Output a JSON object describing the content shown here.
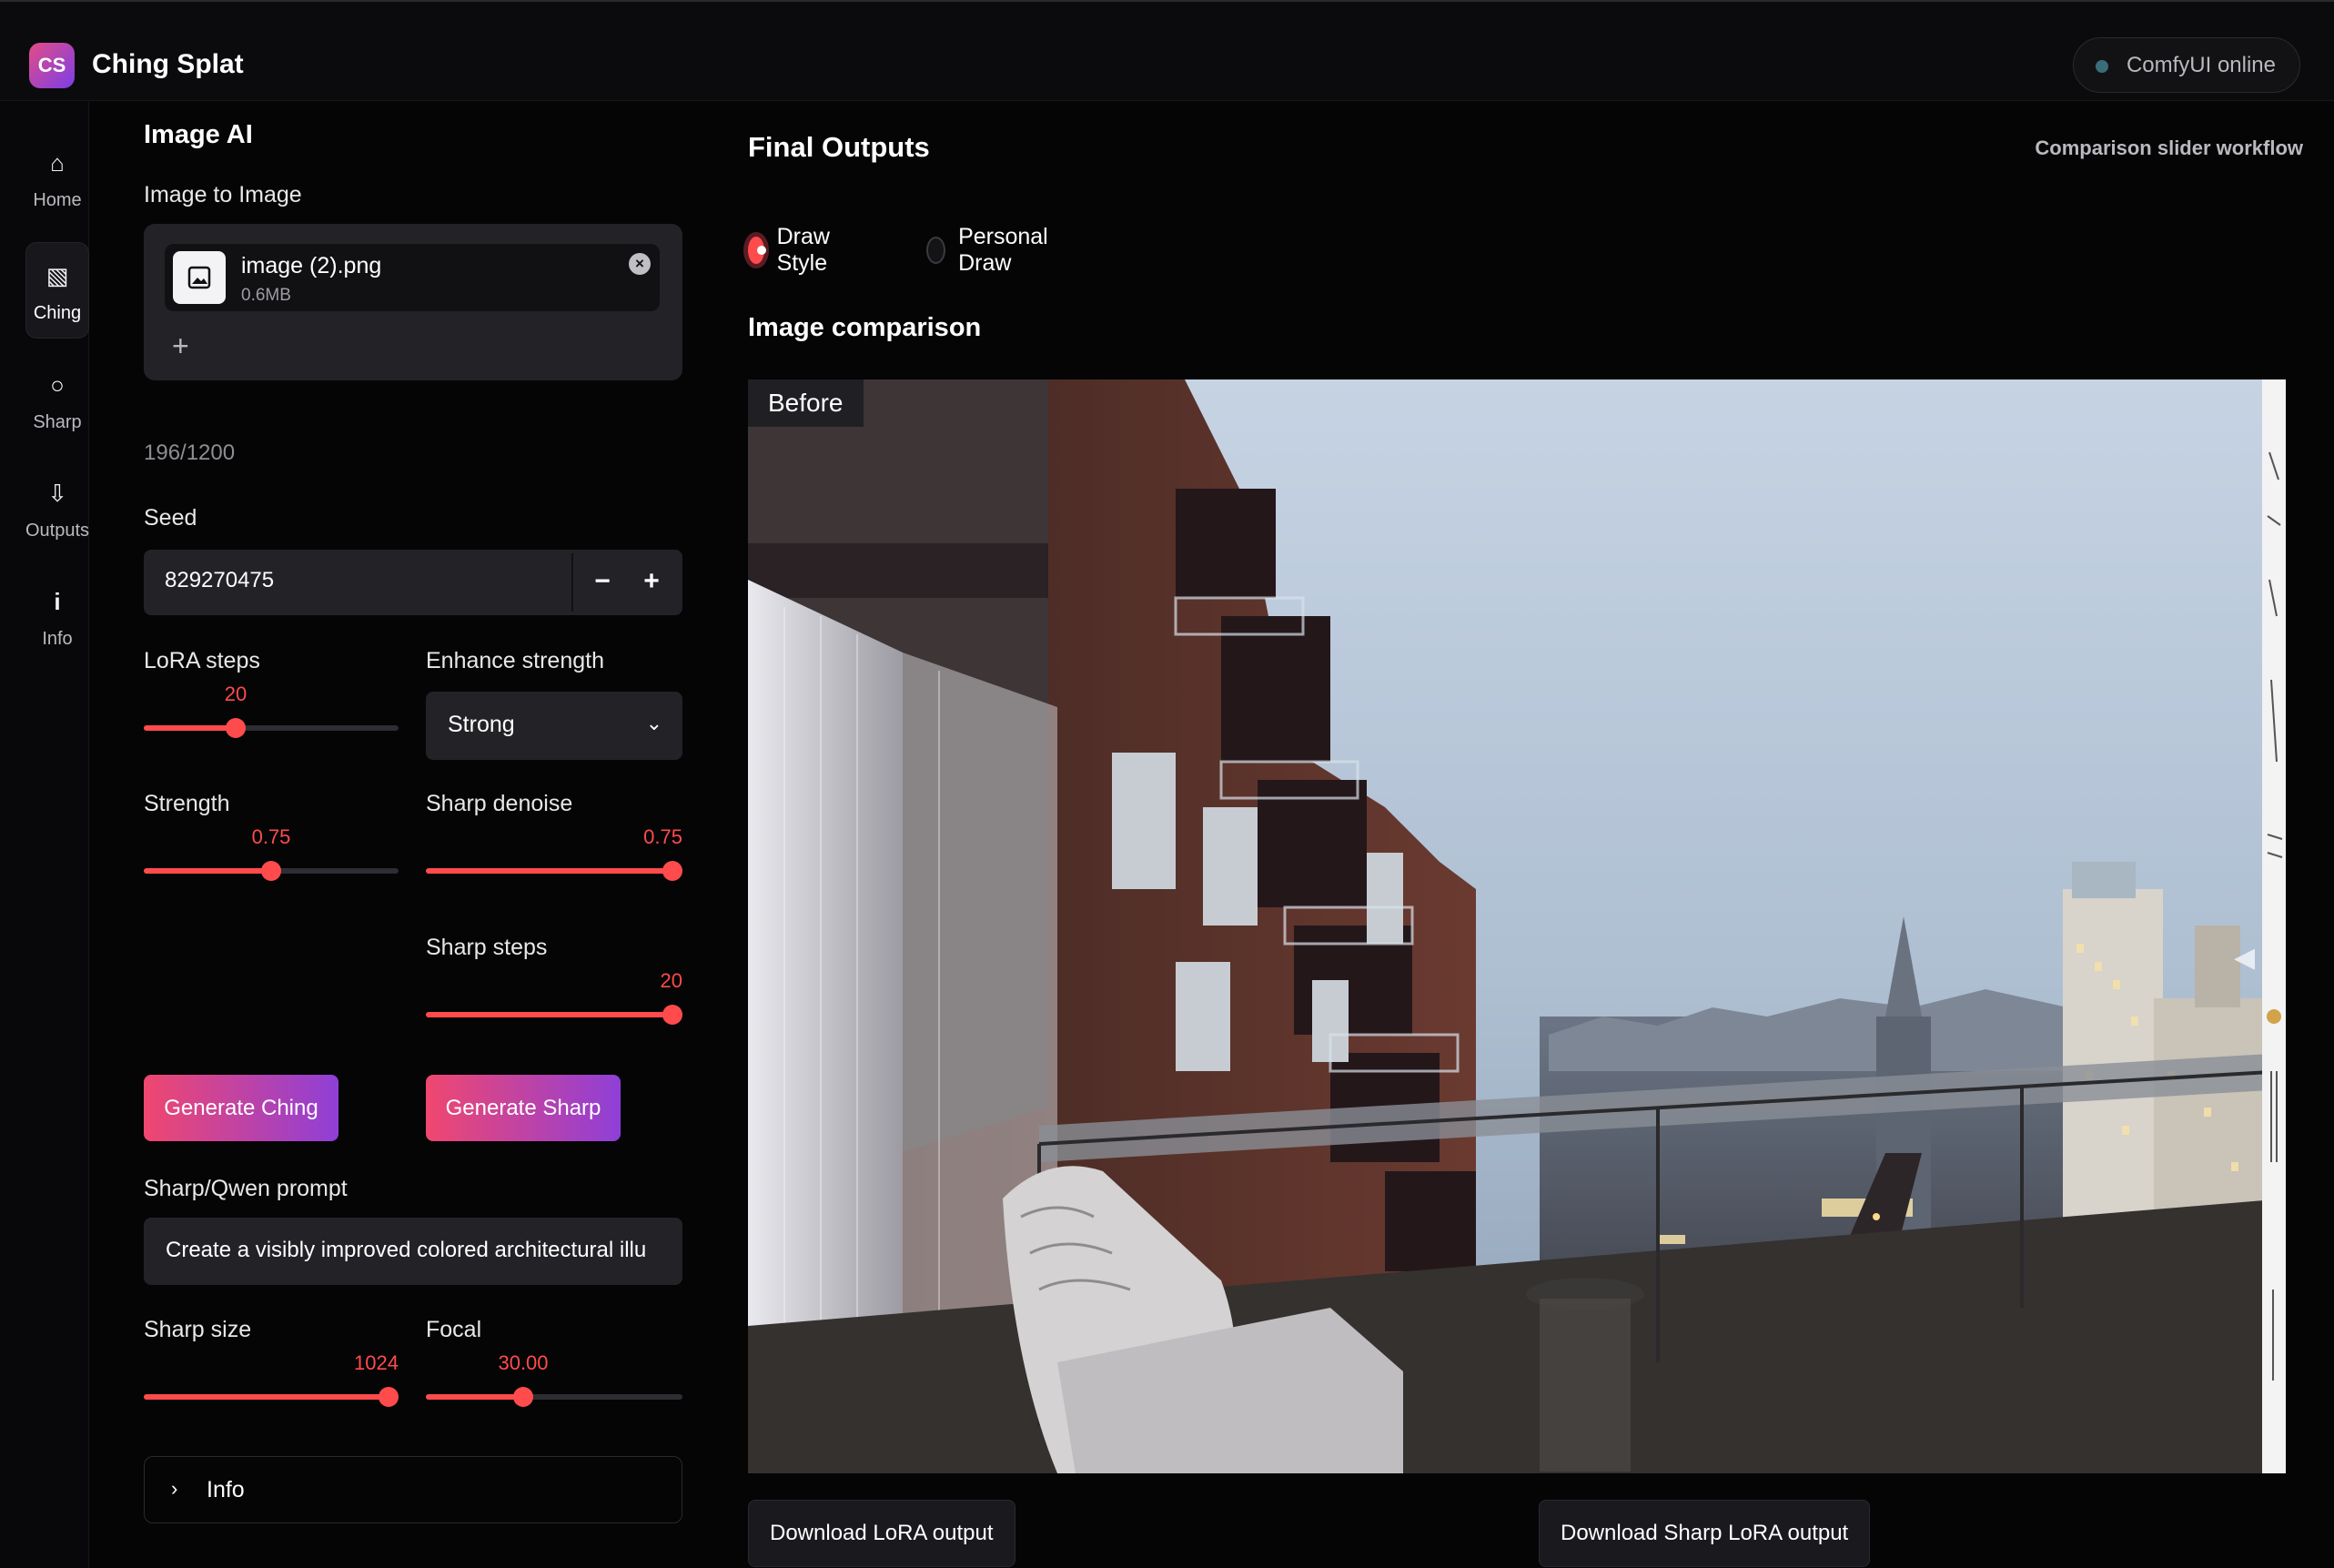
{
  "app": {
    "logo_text": "CS",
    "title": "Ching Splat",
    "status": "ComfyUI online"
  },
  "nav": {
    "items": [
      {
        "label": "Home",
        "icon": "home-icon",
        "glyph": "⌂"
      },
      {
        "label": "Ching",
        "icon": "image-stack-icon",
        "glyph": "▧"
      },
      {
        "label": "Sharp",
        "icon": "circle-icon",
        "glyph": "○"
      },
      {
        "label": "Outputs",
        "icon": "download-icon",
        "glyph": "⇩"
      },
      {
        "label": "Info",
        "icon": "info-icon",
        "glyph": "i"
      }
    ]
  },
  "panel": {
    "section_title": "Image AI",
    "upload_label": "Image to Image",
    "file": {
      "name": "image (2).png",
      "size": "0.6MB"
    },
    "add_glyph": "+",
    "counter": "196/1200",
    "seed": {
      "label": "Seed",
      "value": "829270475",
      "minus": "−",
      "plus": "+"
    },
    "lora_steps": {
      "label": "LoRA steps",
      "value": "20",
      "fraction": 0.36
    },
    "enhance_strength": {
      "label": "Enhance strength",
      "value": "Strong"
    },
    "strength": {
      "label": "Strength",
      "value": "0.75",
      "fraction": 0.5
    },
    "sharp_denoise": {
      "label": "Sharp denoise",
      "value": "0.75",
      "fraction": 0.96
    },
    "sharp_steps": {
      "label": "Sharp steps",
      "value": "20",
      "fraction": 0.96
    },
    "generate_ching": "Generate Ching",
    "generate_sharp": "Generate Sharp",
    "prompt": {
      "label": "Sharp/Qwen prompt",
      "value": "Create a visibly improved colored architectural illu"
    },
    "sharp_size": {
      "label": "Sharp size",
      "value": "1024",
      "fraction": 0.96
    },
    "focal": {
      "label": "Focal",
      "value": "30.00",
      "fraction": 0.38
    },
    "info_expander": "Info"
  },
  "main": {
    "title": "Final Outputs",
    "workflow": "Comparison slider workflow",
    "radio": {
      "option1": "Draw Style",
      "option2": "Personal Draw",
      "selected": "Draw Style"
    },
    "comparison_title": "Image comparison",
    "before_label": "Before",
    "download_lora": "Download LoRA output",
    "download_sharp": "Download Sharp LoRA output"
  },
  "colors": {
    "accent": "#ff4b4b",
    "gradient_start": "#f0476f",
    "gradient_end": "#8f3fd8"
  }
}
